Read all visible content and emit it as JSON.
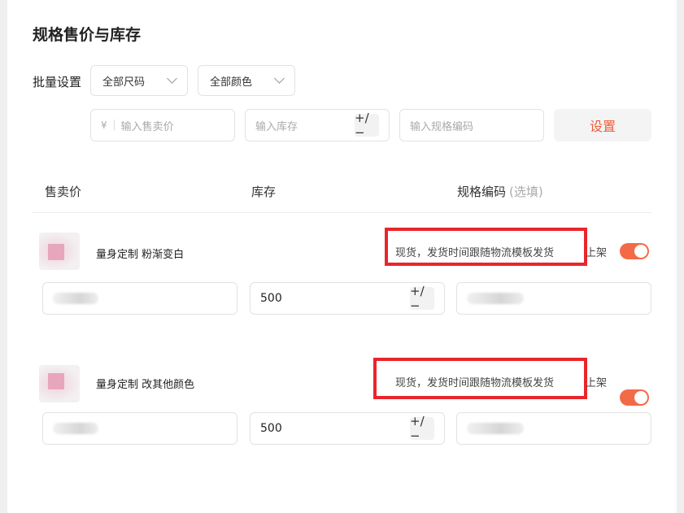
{
  "section_title": "规格售价与库存",
  "batch": {
    "label": "批量设置",
    "size_select": "全部尺码",
    "color_select": "全部颜色",
    "price_currency": "¥",
    "price_placeholder": "输入售卖价",
    "stock_placeholder": "输入库存",
    "code_placeholder": "输入规格编码",
    "plus_minus": "+/−",
    "set_button": "设置"
  },
  "columns": {
    "price": "售卖价",
    "stock": "库存",
    "code": "规格编码",
    "code_optional": "(选填)"
  },
  "variants": [
    {
      "name": "量身定制 粉渐变白",
      "shipping": "现货，发货时间跟随物流模板发货",
      "shelf_label": "上架",
      "shelf_on": true,
      "stock": "500",
      "plus_minus": "+/−"
    },
    {
      "name": "量身定制 改其他颜色",
      "shipping": "现货，发货时间跟随物流模板发货",
      "shelf_label": "上架",
      "shelf_on": true,
      "stock": "500",
      "plus_minus": "+/−"
    }
  ],
  "colors": {
    "accent": "#ef5b3a",
    "toggle_on": "#f36a46",
    "highlight_box": "#e8262b"
  }
}
